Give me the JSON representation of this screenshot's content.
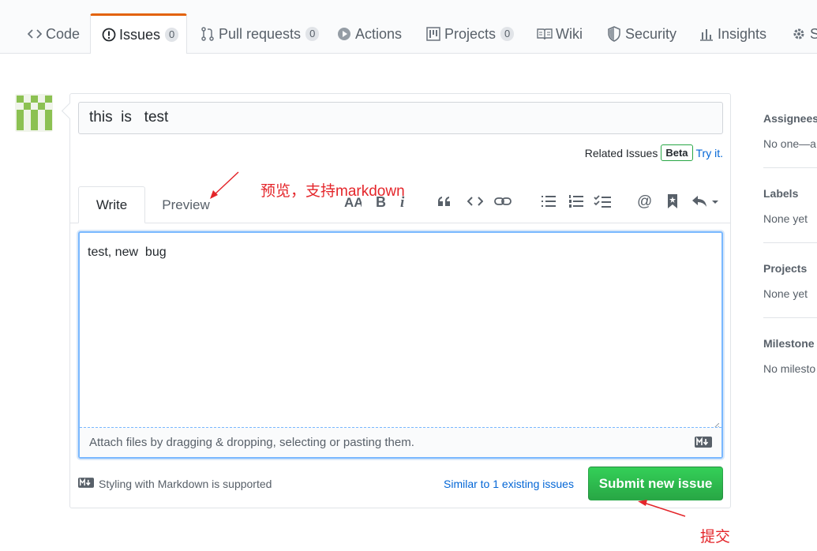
{
  "nav": {
    "tabs": [
      {
        "label": "Code"
      },
      {
        "label": "Issues",
        "count": "0"
      },
      {
        "label": "Pull requests",
        "count": "0"
      },
      {
        "label": "Actions"
      },
      {
        "label": "Projects",
        "count": "0"
      },
      {
        "label": "Wiki"
      },
      {
        "label": "Security"
      },
      {
        "label": "Insights"
      },
      {
        "label": "S"
      }
    ]
  },
  "issue": {
    "title_value": "this  is   test",
    "related_label": "Related Issues",
    "beta_label": "Beta",
    "try_it": "Try it.",
    "write_tab": "Write",
    "preview_tab": "Preview",
    "body_value": "test, new  bug",
    "drop_hint": "Attach files by dragging & dropping, selecting or pasting them.",
    "markdown_support": "Styling with Markdown is supported",
    "similar_issues": "Similar to 1 existing issues",
    "submit_label": "Submit new issue"
  },
  "toolbar": {
    "icons": [
      "text-size-icon",
      "bold-icon",
      "italic-icon",
      "quote-icon",
      "code-icon",
      "link-icon",
      "bullet-list-icon",
      "numbered-list-icon",
      "task-list-icon",
      "mention-icon",
      "saved-reply-icon",
      "reply-icon"
    ]
  },
  "sidebar": {
    "assignees_title": "Assignees",
    "assignees_value": "No one—a",
    "labels_title": "Labels",
    "labels_value": "None yet",
    "projects_title": "Projects",
    "projects_value": "None yet",
    "milestone_title": "Milestone",
    "milestone_value": "No milesto"
  },
  "annotations": {
    "preview_note": "预览，支持markdown",
    "submit_note": "提交"
  },
  "colors": {
    "accent_tab": "#e36209",
    "submit_green": "#2ea44f",
    "link_blue": "#0366d6",
    "annotation_red": "#e4252a"
  }
}
